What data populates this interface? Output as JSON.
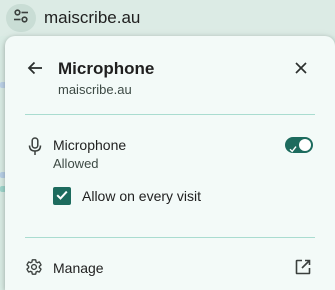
{
  "addressbar": {
    "url": "maiscribe.au",
    "site_info_icon": "tune-icon"
  },
  "popup": {
    "title": "Microphone",
    "subtitle": "maiscribe.au",
    "back_icon": "arrow-back-icon",
    "close_icon": "close-icon",
    "permission": {
      "icon": "microphone-icon",
      "label": "Microphone",
      "status": "Allowed",
      "enabled": true
    },
    "checkbox": {
      "label": "Allow on every visit",
      "checked": true
    },
    "manage": {
      "icon": "gear-icon",
      "label": "Manage",
      "link_icon": "open-external-icon"
    }
  },
  "colors": {
    "accent": "#1d6b5e",
    "popup_bg": "#f3faf8",
    "divider": "#a9dcd0",
    "toolbar_bg": "#dcebe5"
  }
}
